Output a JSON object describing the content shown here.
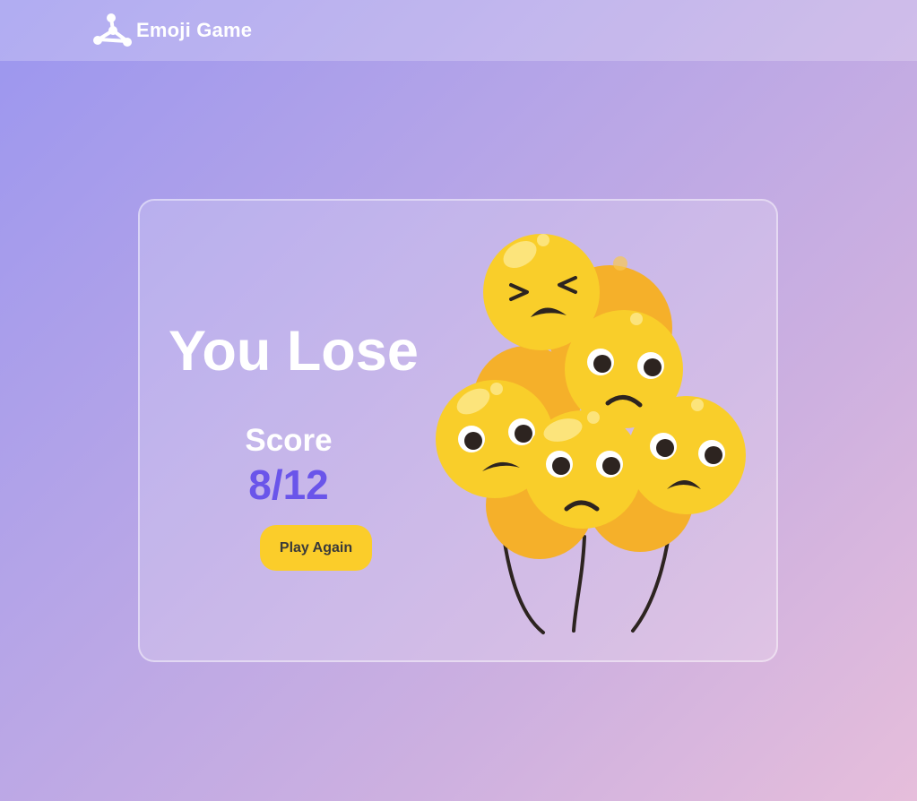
{
  "navbar": {
    "brand_title": "Emoji Game",
    "logo_icon": "molecule-logo-icon"
  },
  "result": {
    "title": "You Lose",
    "score_label": "Score",
    "score_value": "8/12",
    "play_again_label": "Play Again",
    "illustration": "sad-emoji-balloons-image"
  },
  "colors": {
    "accent_score": "#6a55ea",
    "button_bg": "#fbcd2a",
    "emoji_face": "#f9ce2a"
  }
}
